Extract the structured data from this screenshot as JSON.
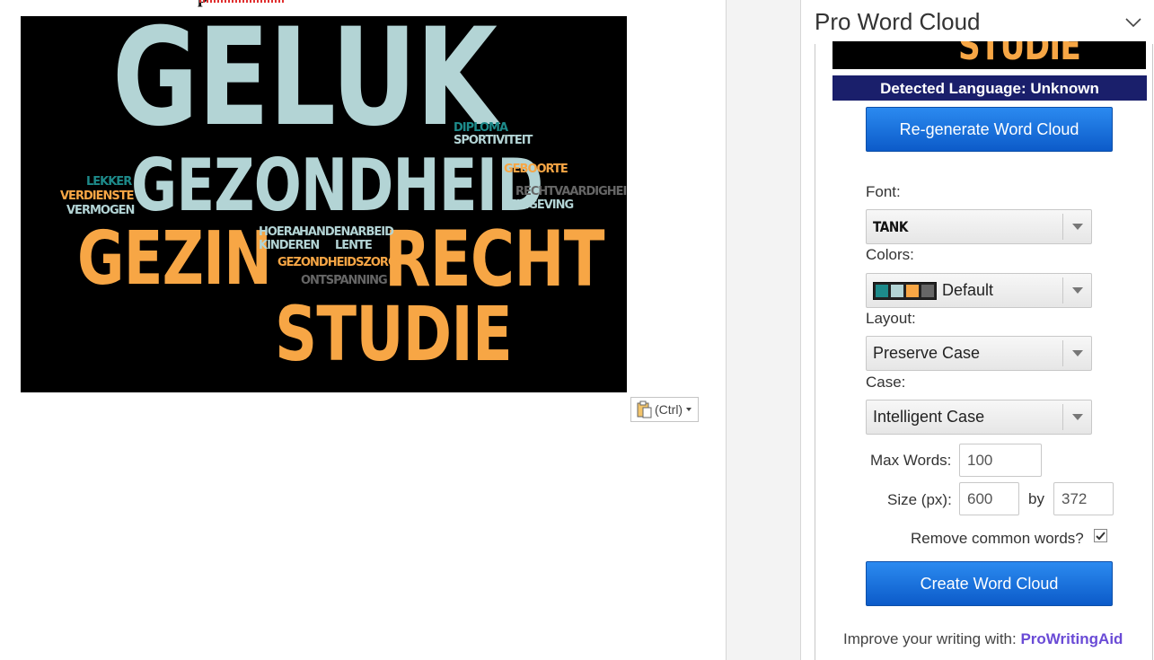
{
  "document": {
    "heading_fragment": "p"
  },
  "word_cloud": [
    {
      "text": "GELUK",
      "color": "#b3d4d5"
    },
    {
      "text": "GEZONDHEID",
      "color": "#b3d4d5"
    },
    {
      "text": "GEZIN",
      "color": "#f7a645"
    },
    {
      "text": "RECHT",
      "color": "#f7a645"
    },
    {
      "text": "STUDIE",
      "color": "#f7a645"
    },
    {
      "text": "DIPLOMA",
      "color": "#1d8a8a"
    },
    {
      "text": "SPORTIVITEIT",
      "color": "#b3d4d5"
    },
    {
      "text": "GEBOORTE",
      "color": "#f7a645"
    },
    {
      "text": "RECHTVAARDIGHEID",
      "color": "#666666"
    },
    {
      "text": "ZINGEVING",
      "color": "#b3d4d5"
    },
    {
      "text": "LEKKER",
      "color": "#1d8a8a"
    },
    {
      "text": "VERDIENSTE",
      "color": "#f7a645"
    },
    {
      "text": "VERMOGEN",
      "color": "#b3d4d5"
    },
    {
      "text": "HOERA",
      "color": "#b3d4d5"
    },
    {
      "text": "HANDENARBEID",
      "color": "#b3d4d5"
    },
    {
      "text": "KINDEREN",
      "color": "#b3d4d5"
    },
    {
      "text": "LENTE",
      "color": "#b3d4d5"
    },
    {
      "text": "GEZONDHEIDSZORG",
      "color": "#f7a645"
    },
    {
      "text": "ONTSPANNING",
      "color": "#666666"
    }
  ],
  "paste_options": {
    "label": "(Ctrl)",
    "icon": "clipboard-icon"
  },
  "pane": {
    "title": "Pro Word Cloud",
    "collapse_icon": "chevron-down-icon",
    "preview_word": "STUDIE",
    "detected_language": "Detected Language: Unknown",
    "regenerate_label": "Re-generate Word Cloud",
    "font_label": "Font:",
    "font_value": "TANK",
    "colors_label": "Colors:",
    "colors_value": "Default",
    "color_swatches": [
      "#1d8a8a",
      "#b3d4d5",
      "#f7a645",
      "#666666"
    ],
    "layout_label": "Layout:",
    "layout_value": "Preserve Case",
    "case_label": "Case:",
    "case_value": "Intelligent Case",
    "max_words_label": "Max Words:",
    "max_words_value": "100",
    "size_label": "Size (px):",
    "size_width": "600",
    "size_by": "by",
    "size_height": "372",
    "remove_common_label": "Remove common words?",
    "remove_common_checked": true,
    "create_label": "Create Word Cloud",
    "footer_text": "Improve your writing with:",
    "footer_link": "ProWritingAid"
  }
}
